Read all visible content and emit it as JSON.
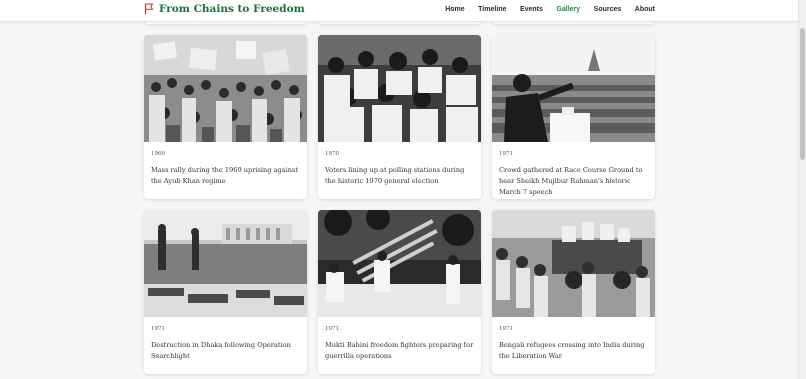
{
  "site": {
    "title": "From Chains to Freedom",
    "accent_color": "#1f6e3f",
    "logo_icon": "flag-icon"
  },
  "nav": {
    "items": [
      {
        "label": "Home",
        "active": false
      },
      {
        "label": "Timeline",
        "active": false
      },
      {
        "label": "Events",
        "active": false
      },
      {
        "label": "Gallery",
        "active": true
      },
      {
        "label": "Sources",
        "active": false
      },
      {
        "label": "About",
        "active": false
      }
    ]
  },
  "gallery": {
    "items": [
      {
        "year": "1969",
        "caption": "Mass rally during the 1969 uprising against the Ayub Khan regime"
      },
      {
        "year": "1970",
        "caption": "Voters lining up at polling stations during the historic 1970 general election"
      },
      {
        "year": "1971",
        "caption": "Crowd gathered at Race Course Ground to hear Sheikh Mujibur Rahman's historic March 7 speech"
      },
      {
        "year": "1971",
        "caption": "Destruction in Dhaka following Operation Searchlight"
      },
      {
        "year": "1971",
        "caption": "Mukti Bahini freedom fighters preparing for guerrilla operations"
      },
      {
        "year": "1971",
        "caption": "Bengali refugees crossing into India during the Liberation War"
      }
    ]
  }
}
